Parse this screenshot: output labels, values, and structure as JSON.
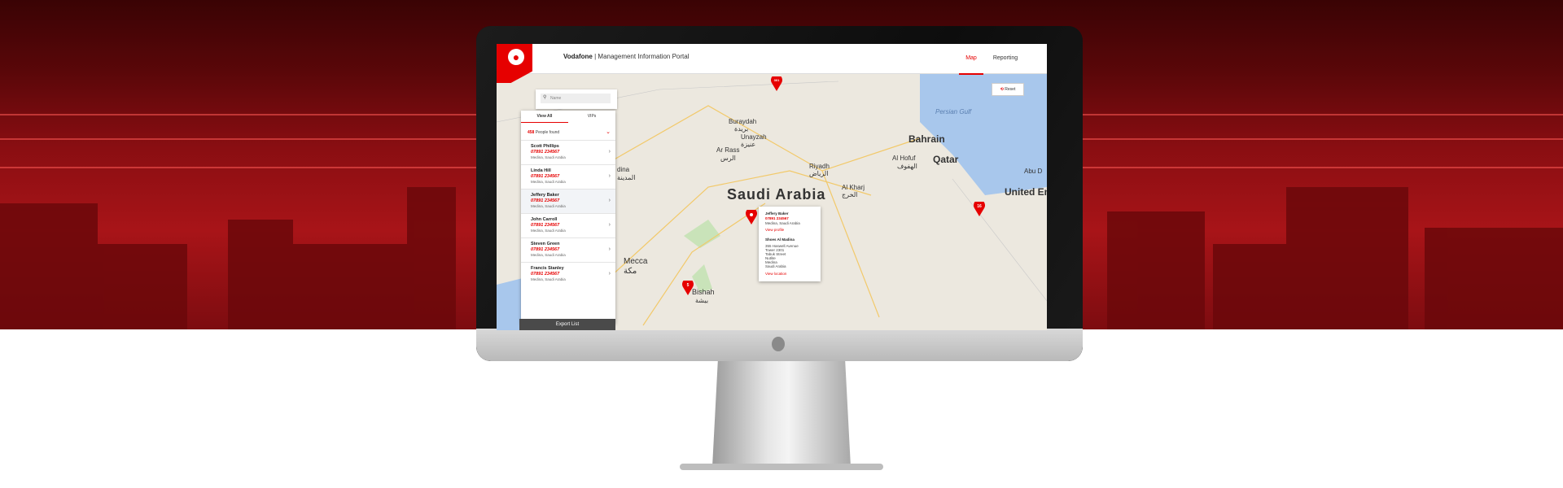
{
  "app": {
    "brand": "Vodafone",
    "title": "Management Information Portal"
  },
  "nav": {
    "map": "Map",
    "reporting": "Reporting"
  },
  "controls": {
    "reset": "Reset"
  },
  "search": {
    "placeholder": "Name"
  },
  "tabs": [
    {
      "label": "View All"
    },
    {
      "label": "VIPs"
    }
  ],
  "summary": {
    "count": "458",
    "label": "People found"
  },
  "people": [
    {
      "name": "Scott Phillips",
      "phone": "07891 234567",
      "location": "Medina, Saudi Arabia"
    },
    {
      "name": "Linda Hill",
      "phone": "07891 234567",
      "location": "Medina, Saudi Arabia"
    },
    {
      "name": "Jeffery Baker",
      "phone": "07891 234567",
      "location": "Medina, Saudi Arabia"
    },
    {
      "name": "John Carroll",
      "phone": "07891 234567",
      "location": "Medina, Saudi Arabia"
    },
    {
      "name": "Steven Green",
      "phone": "07891 234567",
      "location": "Medina, Saudi Arabia"
    },
    {
      "name": "Francis Stanley",
      "phone": "07891 234567",
      "location": "Medina, Saudi Arabia"
    }
  ],
  "export": {
    "label": "Export List"
  },
  "popup": {
    "name": "Jeffery Baker",
    "phone": "07891 234567",
    "location": "Medina, Saudi Arabia",
    "profile_link": "View profile",
    "place": "Shoes Al Madina",
    "address": [
      "355 Haswell Avenue",
      "Tower 2301",
      "Tabuk Street",
      "Nutlite",
      "Medina",
      "Saudi Arabia"
    ],
    "details_link": "View location"
  },
  "map": {
    "labels": {
      "country": "Saudi Arabia",
      "bahrain": "Bahrain",
      "qatar": "Qatar",
      "uae": "United Emira",
      "persian_gulf": "Persian Gulf",
      "buraydah": "Buraydah",
      "buraydah_ar": "بريدة",
      "unayzah": "Unayzah",
      "unayzah_ar": "عنيزة",
      "ar_rass": "Ar Rass",
      "ar_rass_ar": "الرس",
      "riyadh": "Riyadh",
      "riyadh_ar": "الرياض",
      "al_kharj": "Al Kharj",
      "al_kharj_ar": "الخرج",
      "al_hofuf": "Al Hofuf",
      "al_hofuf_ar": "الهفوف",
      "abu_dhabi": "Abu D",
      "medina": "dina",
      "medina_ar": "المدينة",
      "mecca": "Mecca",
      "mecca_ar": "مكة",
      "bishah": "Bishah",
      "bishah_ar": "بيشة"
    },
    "pins": [
      {
        "label": "301",
        "color": "#e60000"
      },
      {
        "label": "16",
        "color": "#e60000"
      },
      {
        "label": "5",
        "color": "#e60000"
      }
    ]
  },
  "colors": {
    "brand": "#e60000",
    "panel_dark": "#4a4a4a"
  }
}
